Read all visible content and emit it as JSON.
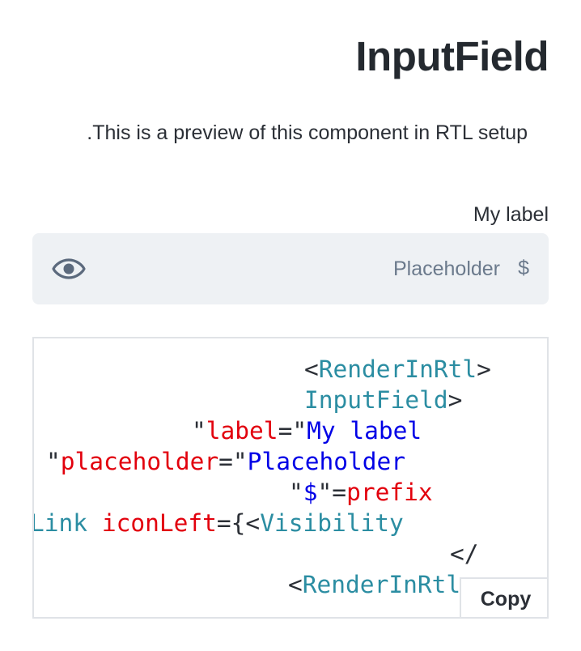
{
  "page": {
    "title": "InputField",
    "intro": ".This is a preview of this component in RTL setup"
  },
  "field": {
    "label": "My label",
    "placeholder": "Placeholder",
    "prefix": "$",
    "icon": "eye-icon"
  },
  "code": {
    "line1": {
      "open": "<",
      "tag": "RenderInRtl",
      "close": ">"
    },
    "line2": {
      "tag": "InputField",
      "close": ">"
    },
    "line3": {
      "q1": "\"",
      "attr": "label",
      "eq": "=\"",
      "value": "My label"
    },
    "line4": {
      "q1": "\"",
      "attr": "placeholder",
      "eq": "=\"",
      "value": "Placeholder"
    },
    "line5": {
      "q1": "\"",
      "value": "$",
      "eq": "\"=",
      "attr": "prefix"
    },
    "line6": {
      "tag1": "Link",
      "attr": "iconLeft",
      "eq": "={<",
      "tag2": "Visibility"
    },
    "line7": {
      "text": "</"
    },
    "line8": {
      "open": "<",
      "tag": "RenderInRtl",
      "close": ">"
    },
    "copy_label": "Copy"
  },
  "colors": {
    "tag": "#2b8da2",
    "attribute": "#e2000d",
    "string": "#0000e6",
    "input_background": "#eef1f4",
    "muted": "#6b7a8c"
  }
}
